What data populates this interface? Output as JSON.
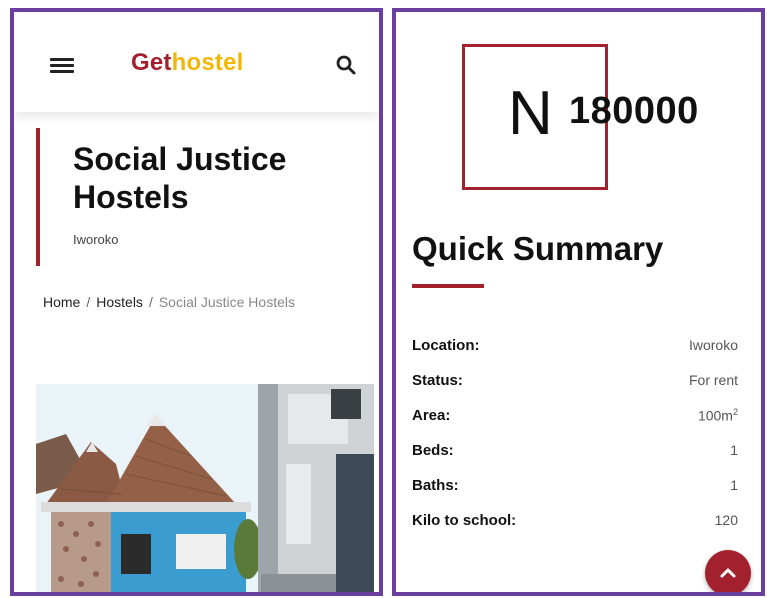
{
  "header": {
    "logo_part1": "Get",
    "logo_part2": "hostel",
    "menu_icon": "hamburger-menu-icon",
    "search_icon": "search-icon"
  },
  "property": {
    "title": "Social Justice Hostels",
    "location_subtitle": "Iworoko"
  },
  "breadcrumb": {
    "home": "Home",
    "sep1": "/",
    "hostels": "Hostels",
    "sep2": "/",
    "current": "Social Justice Hostels"
  },
  "price": {
    "currency": "N",
    "amount": "180000"
  },
  "summary": {
    "title": "Quick Summary",
    "rows": [
      {
        "label": "Location:",
        "value": "Iworoko"
      },
      {
        "label": "Status:",
        "value": "For rent"
      },
      {
        "label": "Area:",
        "value": "100m",
        "sup": "2"
      },
      {
        "label": "Beds:",
        "value": "1"
      },
      {
        "label": "Baths:",
        "value": "1"
      },
      {
        "label": "Kilo to school:",
        "value": "120"
      }
    ]
  },
  "colors": {
    "brand_red": "#a3202f",
    "brand_yellow": "#f2b705",
    "frame_purple": "#6a3fa0"
  },
  "scroll_top_icon": "chevron-up-icon"
}
